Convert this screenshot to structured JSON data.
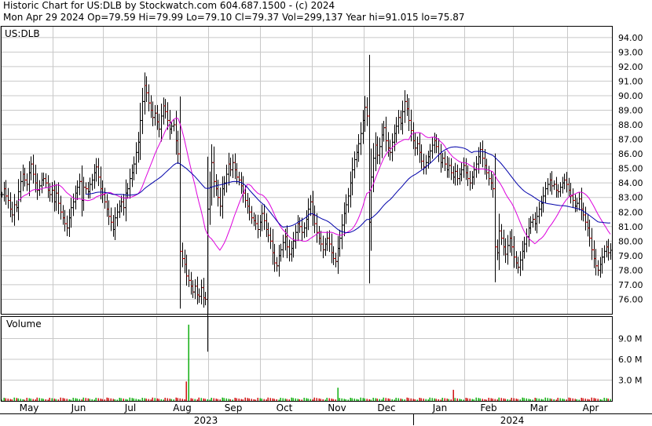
{
  "header": {
    "line1": "Historic Chart for US:DLB by Stockwatch.com 604.687.1500 - (c) 2024",
    "line2": "Mon Apr 29 2024  Op=79.59  Hi=79.99  Lo=79.10  Cl=79.37  Vol=299,137  Year hi=91.015  lo=75.87"
  },
  "chart_data": [
    {
      "type": "ohlc",
      "symbol_label": "US:DLB",
      "title": "",
      "ylim": [
        75.0,
        94.8
      ],
      "yticks": [
        76,
        77,
        78,
        79,
        80,
        81,
        82,
        83,
        84,
        85,
        86,
        87,
        88,
        89,
        90,
        91,
        92,
        93,
        94
      ],
      "ytick_labels": [
        "76.00",
        "77.00",
        "78.00",
        "79.00",
        "80.00",
        "81.00",
        "82.00",
        "83.00",
        "84.00",
        "85.00",
        "86.00",
        "87.00",
        "88.00",
        "89.00",
        "90.00",
        "91.00",
        "92.00",
        "93.00",
        "94.00"
      ],
      "x_months": [
        "May",
        "Jun",
        "Jul",
        "Aug",
        "Sep",
        "Oct",
        "Nov",
        "Dec",
        "Jan",
        "Feb",
        "Mar",
        "Apr"
      ],
      "x_years": [
        "2023",
        "2024"
      ],
      "grid": true,
      "colors": {
        "up": "#000000",
        "down": "#cc0000",
        "ma_short": "#dd00dd",
        "ma_long": "#0000aa",
        "grid": "#c8c8c8"
      },
      "closes": [
        83.2,
        83.6,
        83.1,
        82.8,
        82.2,
        81.8,
        82.5,
        82.3,
        83.4,
        84.1,
        84.6,
        84.2,
        83.9,
        84.7,
        85.3,
        84.6,
        84.0,
        83.5,
        83.8,
        84.2,
        84.3,
        84.0,
        83.5,
        83.2,
        83.5,
        82.7,
        83.3,
        82.6,
        82.0,
        81.6,
        81.2,
        80.9,
        81.6,
        82.3,
        82.7,
        83.3,
        83.7,
        84.1,
        82.8,
        83.7,
        83.6,
        83.4,
        83.9,
        84.2,
        84.7,
        85.1,
        84.4,
        83.6,
        83.2,
        82.7,
        82.2,
        81.7,
        81.3,
        80.8,
        81.6,
        82.0,
        82.4,
        82.7,
        82.3,
        83.3,
        83.6,
        84.3,
        84.7,
        85.3,
        86.1,
        86.8,
        88.3,
        89.6,
        90.7,
        90.2,
        89.5,
        89.0,
        88.5,
        88.8,
        88.2,
        87.7,
        88.6,
        89.3,
        88.9,
        88.3,
        87.7,
        87.9,
        88.0,
        86.9,
        86.0,
        79.3,
        78.8,
        78.4,
        77.6,
        77.3,
        76.9,
        76.5,
        76.9,
        76.3,
        76.2,
        76.8,
        76.1,
        76.0,
        82.2,
        83.7,
        85.4,
        84.1,
        83.6,
        83.0,
        82.4,
        83.6,
        84.0,
        84.6,
        85.3,
        84.9,
        85.4,
        84.9,
        84.4,
        84.2,
        83.8,
        83.3,
        82.8,
        82.4,
        82.0,
        81.6,
        81.4,
        81.2,
        80.8,
        81.3,
        81.9,
        81.4,
        80.8,
        80.4,
        80.0,
        79.2,
        78.5,
        78.3,
        79.0,
        79.4,
        79.9,
        80.3,
        79.6,
        79.1,
        79.5,
        80.0,
        80.6,
        81.2,
        81.0,
        80.6,
        80.9,
        81.5,
        82.2,
        82.7,
        81.8,
        81.2,
        80.6,
        80.2,
        79.8,
        79.4,
        79.8,
        80.2,
        79.8,
        79.2,
        78.8,
        78.6,
        79.5,
        80.2,
        81.1,
        81.9,
        82.5,
        83.1,
        84.0,
        84.9,
        85.6,
        86.1,
        86.7,
        87.4,
        88.3,
        89.2,
        88.6,
        81.3,
        84.4,
        85.7,
        86.6,
        85.9,
        86.5,
        87.3,
        87.8,
        86.9,
        86.4,
        86.1,
        86.8,
        87.4,
        87.9,
        88.5,
        88.1,
        88.9,
        89.6,
        89.1,
        88.3,
        87.6,
        86.9,
        86.4,
        86.7,
        86.1,
        85.5,
        85.1,
        85.4,
        85.8,
        86.2,
        86.6,
        86.9,
        86.5,
        86.0,
        85.4,
        85.7,
        85.3,
        84.9,
        85.2,
        84.7,
        84.4,
        84.8,
        84.3,
        84.6,
        84.9,
        85.2,
        84.7,
        84.3,
        84.0,
        84.4,
        84.9,
        85.3,
        85.8,
        86.3,
        85.7,
        85.2,
        84.7,
        84.3,
        84.0,
        83.6,
        79.6,
        79.2,
        80.7,
        80.2,
        79.6,
        79.1,
        79.7,
        80.2,
        79.6,
        78.9,
        78.5,
        78.2,
        78.7,
        79.3,
        79.8,
        80.3,
        80.9,
        81.3,
        81.5,
        81.2,
        81.7,
        82.2,
        82.6,
        83.1,
        83.6,
        83.9,
        84.2,
        83.8,
        83.9,
        83.5,
        83.4,
        83.7,
        84.0,
        84.2,
        83.9,
        83.5,
        83.1,
        82.8,
        82.4,
        82.6,
        82.9,
        82.2,
        81.8,
        81.3,
        80.9,
        80.2,
        79.4,
        78.8,
        78.3,
        78.0,
        78.4,
        78.9,
        79.3,
        79.6,
        79.2,
        79.37
      ]
    },
    {
      "type": "bar",
      "title": "Volume",
      "ylim": [
        0,
        12000000
      ],
      "yticks": [
        3000000,
        6000000,
        9000000
      ],
      "ytick_labels": [
        "3.0 M",
        "6.0 M",
        "9.0 M"
      ],
      "spikes": [
        {
          "month": "Aug",
          "value": 11000000
        },
        {
          "month": "Aug",
          "value": 2800000
        },
        {
          "month": "Nov",
          "value": 1900000
        },
        {
          "month": "Jan",
          "value": 1600000
        }
      ],
      "typical_value": 300000
    }
  ]
}
